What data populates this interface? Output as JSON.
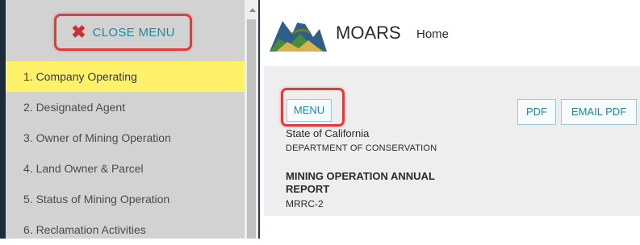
{
  "sidebar": {
    "close_label": "CLOSE MENU",
    "items": [
      {
        "label": "1. Company Operating",
        "active": true
      },
      {
        "label": "2. Designated Agent",
        "active": false
      },
      {
        "label": "3. Owner of Mining Operation",
        "active": false
      },
      {
        "label": "4. Land Owner & Parcel",
        "active": false
      },
      {
        "label": "5. Status of Mining Operation",
        "active": false
      },
      {
        "label": "6. Reclamation Activities",
        "active": false
      }
    ]
  },
  "header": {
    "app_name": "MOARS",
    "nav_home": "Home",
    "logo_icon": "mountain-seal-logo"
  },
  "content": {
    "menu_button": "MENU",
    "pdf_button": "PDF",
    "email_pdf_button": "EMAIL PDF",
    "state": "State of California",
    "department": "DEPARTMENT OF CONSERVATION",
    "report_title": "MINING OPERATION ANNUAL REPORT",
    "report_code": "MRRC-2"
  },
  "colors": {
    "accent_teal": "#1f8a9e",
    "highlight_yellow": "#fff16a",
    "annotation_red": "#e23b3b",
    "sidebar_bg": "#d2d2d2"
  }
}
